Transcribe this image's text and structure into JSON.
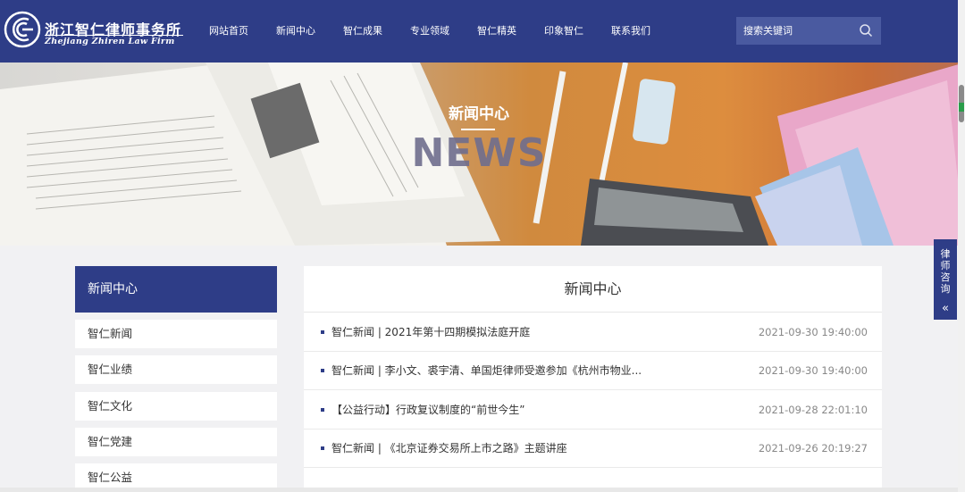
{
  "header": {
    "logo_cn": "浙江智仁律师事务所",
    "logo_en": "Zhejiang Zhiren Law Firm",
    "nav": [
      "网站首页",
      "新闻中心",
      "智仁成果",
      "专业领域",
      "智仁精英",
      "印象智仁",
      "联系我们"
    ],
    "search_placeholder": "搜索关键词"
  },
  "banner": {
    "title": "新闻中心",
    "subtitle_en": "NEWS"
  },
  "sidebar": {
    "heading": "新闻中心",
    "items": [
      "智仁新闻",
      "智仁业绩",
      "智仁文化",
      "智仁党建",
      "智仁公益"
    ]
  },
  "main": {
    "title": "新闻中心",
    "news": [
      {
        "title": "智仁新闻 | 2021年第十四期模拟法庭开庭",
        "date": "2021-09-30 19:40:00"
      },
      {
        "title": "智仁新闻 | 李小文、裘宇清、单国炬律师受邀参加《杭州市物业...",
        "date": "2021-09-30 19:40:00"
      },
      {
        "title": "【公益行动】行政复议制度的“前世今生”",
        "date": "2021-09-28 22:01:10"
      },
      {
        "title": "智仁新闻 | 《北京证券交易所上市之路》主题讲座",
        "date": "2021-09-26 20:19:27"
      }
    ]
  },
  "consult": {
    "label": "律师咨询",
    "arrow": "«"
  },
  "colors": {
    "primary": "#2e3d87",
    "background": "#f1f1f3"
  }
}
